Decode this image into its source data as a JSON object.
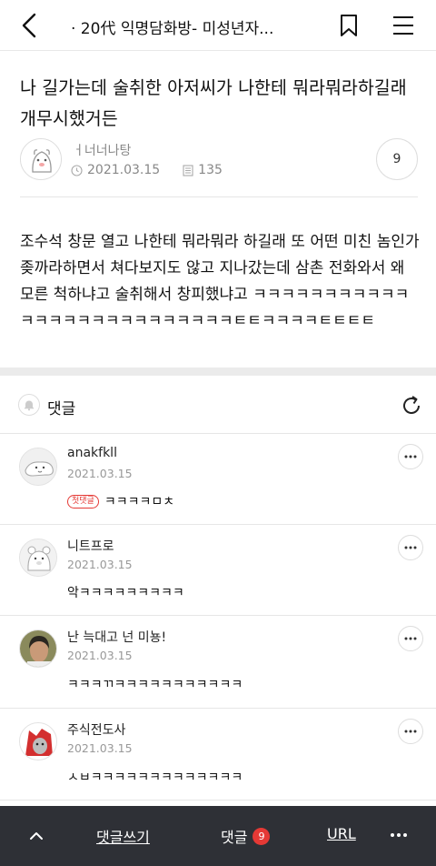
{
  "header": {
    "title": "· 20代 익명담화방- 미성년자...",
    "back_icon": "back-chevron-icon",
    "bookmark_icon": "bookmark-icon",
    "menu_icon": "hamburger-menu-icon"
  },
  "post": {
    "title": "나 길가는데 술취한 아저씨가 나한테 뭐라뭐라하길래 개무시했거든",
    "author": "ㅓ너너나탕",
    "date": "2021.03.15",
    "views": "135",
    "comment_count": "9",
    "body": "조수석 창문 열고 나한테 뭐라뭐라 하길래 또 어떤 미친 놈인가 좆까라하면서 쳐다보지도 않고 지나갔는데 삼촌 전화와서 왜 모른 척하냐고 술취해서 창피했냐고 ㅋㅋㅋㅋㅋㅋㅋㅋㅋㅋㅋㅋㅋㅋㅋㅋㅋㅋㅋㅋㅋㅋㅋㅋㅋㅋㅌㅌㅋㅋㅋㅋㅌㅌㅌㅌ"
  },
  "comments_section": {
    "label": "댓글",
    "bell_icon": "bell-icon",
    "refresh_icon": "refresh-icon"
  },
  "comments": [
    {
      "name": "anakfkll",
      "date": "2021.03.15",
      "badge": "첫댓글",
      "text": "ㅋㅋㅋㅋㅁㅊ",
      "avatar": "white-creature-avatar"
    },
    {
      "name": "니트프로",
      "date": "2021.03.15",
      "badge": "",
      "text": "악ㅋㅋㅋㅋㅋㅋㅋㅋㅋ",
      "avatar": "bear-avatar"
    },
    {
      "name": "난 늑대고 넌 미뇽!",
      "date": "2021.03.15",
      "badge": "",
      "text": "ㅋㅋㅋㄲㅋㅋㅋㅋㅋㅋㅋㅋㅋㅋㅋ",
      "avatar": "person-photo-avatar"
    },
    {
      "name": "주식전도사",
      "date": "2021.03.15",
      "badge": "",
      "text": "ㅅㅂㅋㅋㅋㅋㅋㅋㅋㅋㅋㅋㅋㅋㅋ",
      "avatar": "character-avatar"
    }
  ],
  "bottom_bar": {
    "up_icon": "chevron-up-icon",
    "write_label": "댓글쓰기",
    "comments_label": "댓글",
    "comments_count": "9",
    "url_label": "URL",
    "more_icon": "more-dots-icon"
  }
}
